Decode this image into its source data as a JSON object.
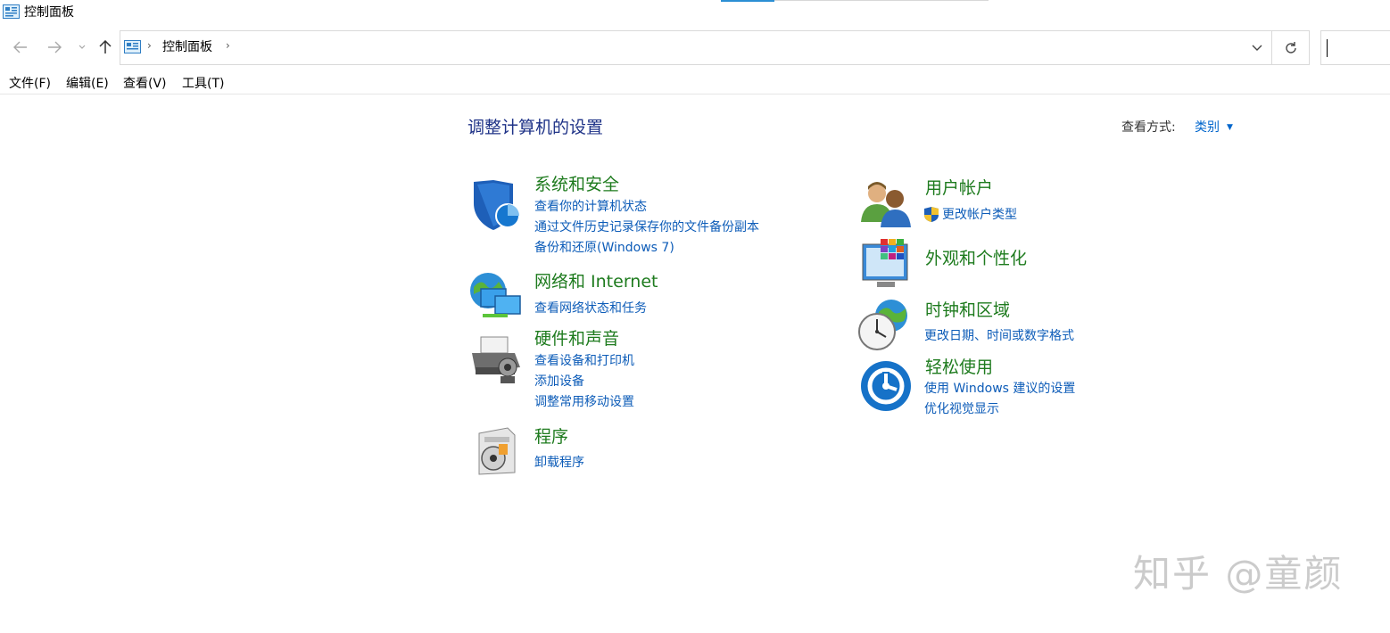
{
  "window": {
    "title": "控制面板",
    "icon": "control-panel-icon"
  },
  "nav": {
    "back_icon": "back-arrow-icon",
    "forward_icon": "forward-arrow-icon",
    "recent_icon": "chevron-down-icon",
    "up_icon": "up-arrow-icon"
  },
  "address": {
    "crumb": "控制面板",
    "separator": "›",
    "dropdown_icon": "chevron-down-icon",
    "refresh_icon": "refresh-icon"
  },
  "search": {
    "value": ""
  },
  "menubar": {
    "file": "文件(F)",
    "edit": "编辑(E)",
    "view": "查看(V)",
    "tools": "工具(T)"
  },
  "main": {
    "heading": "调整计算机的设置",
    "view_by_label": "查看方式:",
    "view_by_value": "类别",
    "categories": [
      {
        "title": "系统和安全",
        "icon": "shield-icon",
        "links": [
          "查看你的计算机状态",
          "通过文件历史记录保存你的文件备份副本",
          "备份和还原(Windows 7)"
        ]
      },
      {
        "title": "网络和 Internet",
        "icon": "network-globe-icon",
        "links": [
          "查看网络状态和任务"
        ]
      },
      {
        "title": "硬件和声音",
        "icon": "printer-icon",
        "links": [
          "查看设备和打印机",
          "添加设备",
          "调整常用移动设置"
        ]
      },
      {
        "title": "程序",
        "icon": "programs-icon",
        "links": [
          "卸载程序"
        ]
      },
      {
        "title": "用户帐户",
        "icon": "users-icon",
        "links": [
          "更改帐户类型"
        ],
        "link_icon": "uac-shield-icon"
      },
      {
        "title": "外观和个性化",
        "icon": "appearance-monitor-icon",
        "links": []
      },
      {
        "title": "时钟和区域",
        "icon": "clock-globe-icon",
        "links": [
          "更改日期、时间或数字格式"
        ]
      },
      {
        "title": "轻松使用",
        "icon": "ease-of-access-icon",
        "links": [
          "使用 Windows 建议的设置",
          "优化视觉显示"
        ]
      }
    ]
  },
  "watermark": "知乎 @童颜"
}
